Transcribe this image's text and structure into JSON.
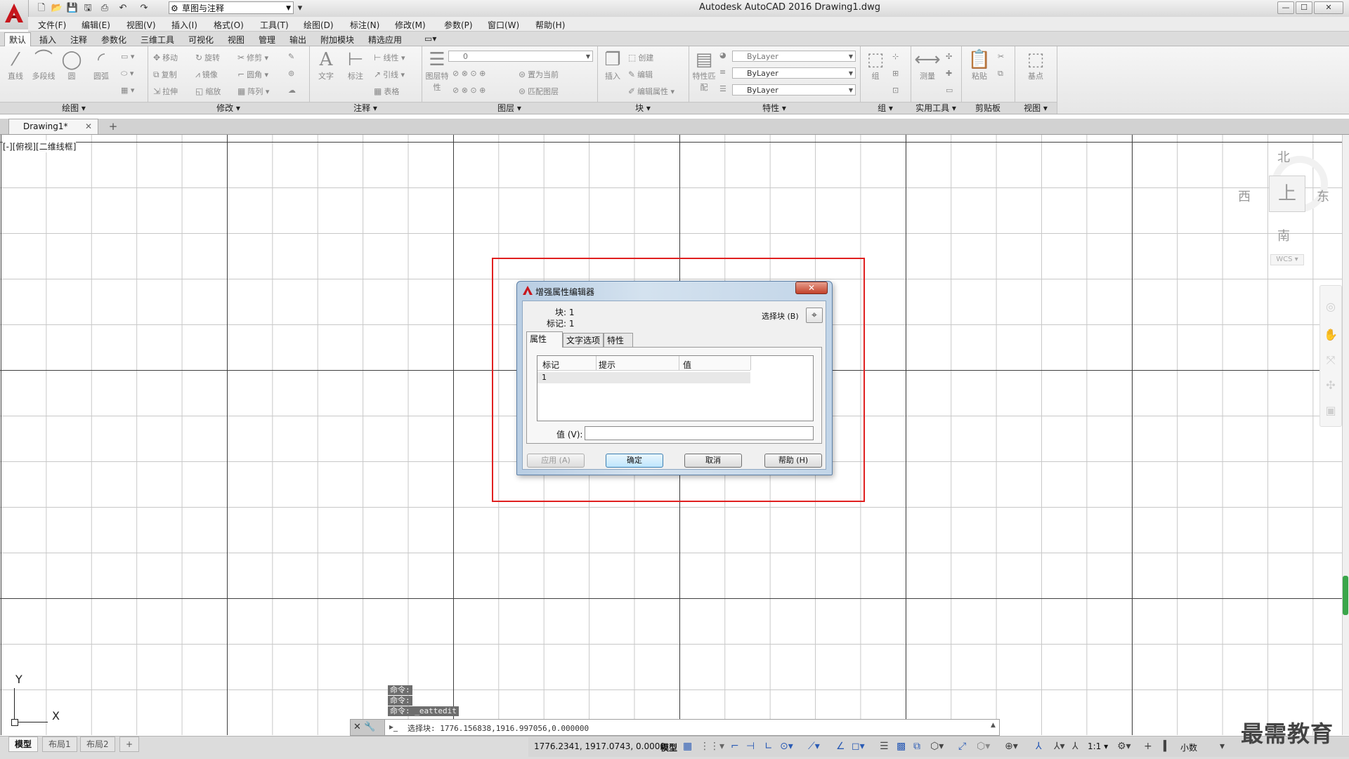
{
  "window": {
    "title": "Autodesk AutoCAD 2016    Drawing1.dwg",
    "workspace": "草图与注释",
    "min_label": "—",
    "max_label": "☐",
    "close_label": "✕"
  },
  "menu": [
    "文件(F)",
    "编辑(E)",
    "视图(V)",
    "插入(I)",
    "格式(O)",
    "工具(T)",
    "绘图(D)",
    "标注(N)",
    "修改(M)",
    "参数(P)",
    "窗口(W)",
    "帮助(H)"
  ],
  "ribbon_tabs": [
    "默认",
    "插入",
    "注释",
    "参数化",
    "三维工具",
    "可视化",
    "视图",
    "管理",
    "输出",
    "附加模块",
    "精选应用"
  ],
  "ribbon": {
    "draw": {
      "title": "绘图 ▾",
      "tools": [
        "直线",
        "多段线",
        "圆",
        "圆弧"
      ]
    },
    "modify": {
      "title": "修改 ▾",
      "tools": [
        "移动",
        "旋转",
        "修剪",
        "复制",
        "镜像",
        "圆角",
        "拉伸",
        "缩放",
        "阵列"
      ]
    },
    "annotation": {
      "title": "注释 ▾",
      "tools": [
        "文字",
        "标注",
        "线性",
        "引线",
        "表格"
      ]
    },
    "layer": {
      "title": "图层 ▾",
      "current": "0",
      "tools": [
        "图层特性",
        "置为当前",
        "匹配图层"
      ]
    },
    "block": {
      "title": "块 ▾",
      "tools": [
        "插入",
        "创建",
        "编辑",
        "编辑属性"
      ]
    },
    "properties": {
      "title": "特性 ▾",
      "match": "特性匹配",
      "color": "ByLayer",
      "linetype": "ByLayer",
      "lineweight": "ByLayer"
    },
    "group": {
      "title": "组 ▾",
      "tool": "组"
    },
    "utilities": {
      "title": "实用工具 ▾",
      "tool": "测量"
    },
    "clipboard": {
      "title": "剪贴板",
      "tool": "粘贴"
    },
    "view": {
      "title": "视图 ▾",
      "tool": "基点"
    }
  },
  "file_tab": {
    "name": "Drawing1*",
    "close": "✕",
    "new": "+"
  },
  "viewport_label": "[-][俯视][二维线框]",
  "viewcube": {
    "north": "北",
    "south": "南",
    "east": "东",
    "west": "西",
    "face": "上",
    "wcs": "WCS ▾"
  },
  "ucs": {
    "x": "X",
    "y": "Y"
  },
  "command": {
    "history": [
      "命令:",
      "命令:",
      "命令:  _eattedit"
    ],
    "current": "选择块: 1776.156838,1916.997056,0.000000"
  },
  "layout_tabs": [
    "模型",
    "布局1",
    "布局2",
    "+"
  ],
  "status": {
    "coords": "1776.2341, 1917.0743, 0.0000",
    "model": "模型",
    "scale": "1:1 ▾",
    "units": "小数"
  },
  "watermark": "最需教育",
  "dialog": {
    "title": "增强属性编辑器",
    "close": "✕",
    "block_label": "块: 1",
    "tag_label": "标记: 1",
    "select_block_label": "选择块 (B)",
    "tabs": [
      "属性",
      "文字选项",
      "特性"
    ],
    "columns": [
      "标记",
      "提示",
      "值"
    ],
    "rows": [
      {
        "tag": "1",
        "prompt": "",
        "value": ""
      }
    ],
    "value_label": "值 (V):",
    "value": "",
    "buttons": {
      "apply": "应用 (A)",
      "ok": "确定",
      "cancel": "取消",
      "help": "帮助 (H)"
    }
  },
  "colors": {
    "highlight": "#e02020",
    "accent": "#2a5bb5"
  }
}
